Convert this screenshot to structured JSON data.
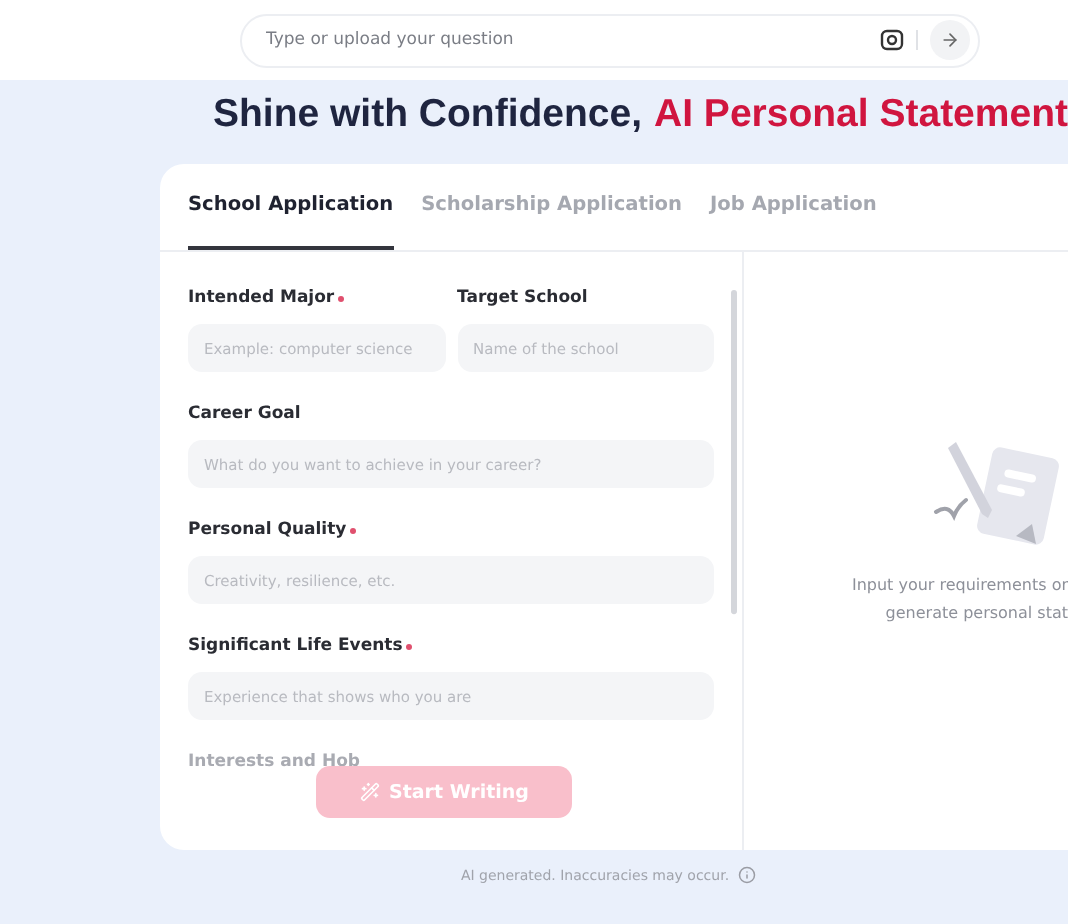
{
  "search": {
    "placeholder": "Type or upload your question"
  },
  "heading": {
    "text": "Shine with Confidence,",
    "highlight": "AI Personal Statement"
  },
  "tabs": [
    {
      "label": "School Application",
      "selected": true
    },
    {
      "label": "Scholarship Application",
      "selected": false
    },
    {
      "label": "Job Application",
      "selected": false
    }
  ],
  "fields": [
    {
      "label": "Intended Major",
      "required": true,
      "placeholder": "Example: computer science",
      "kind": "half"
    },
    {
      "label": "Target School",
      "required": false,
      "placeholder": "Name of the school",
      "kind": "half"
    },
    {
      "label": "Career Goal",
      "required": false,
      "placeholder": "What do you want to achieve in your career?",
      "kind": "full"
    },
    {
      "label": "Personal Quality",
      "required": true,
      "placeholder": "Creativity, resilience, etc.",
      "kind": "full"
    },
    {
      "label": "Significant Life Events",
      "required": true,
      "placeholder": "Experience that shows who you are",
      "kind": "full"
    },
    {
      "label": "Interests and Hob",
      "kind": "faded"
    }
  ],
  "start_button": {
    "label": "Start Writing",
    "disabled": true
  },
  "empty_state": {
    "lines": [
      "Input your requirements or",
      "generate personal stat"
    ]
  },
  "footer": {
    "text": "AI generated. Inaccuracies may occur."
  }
}
